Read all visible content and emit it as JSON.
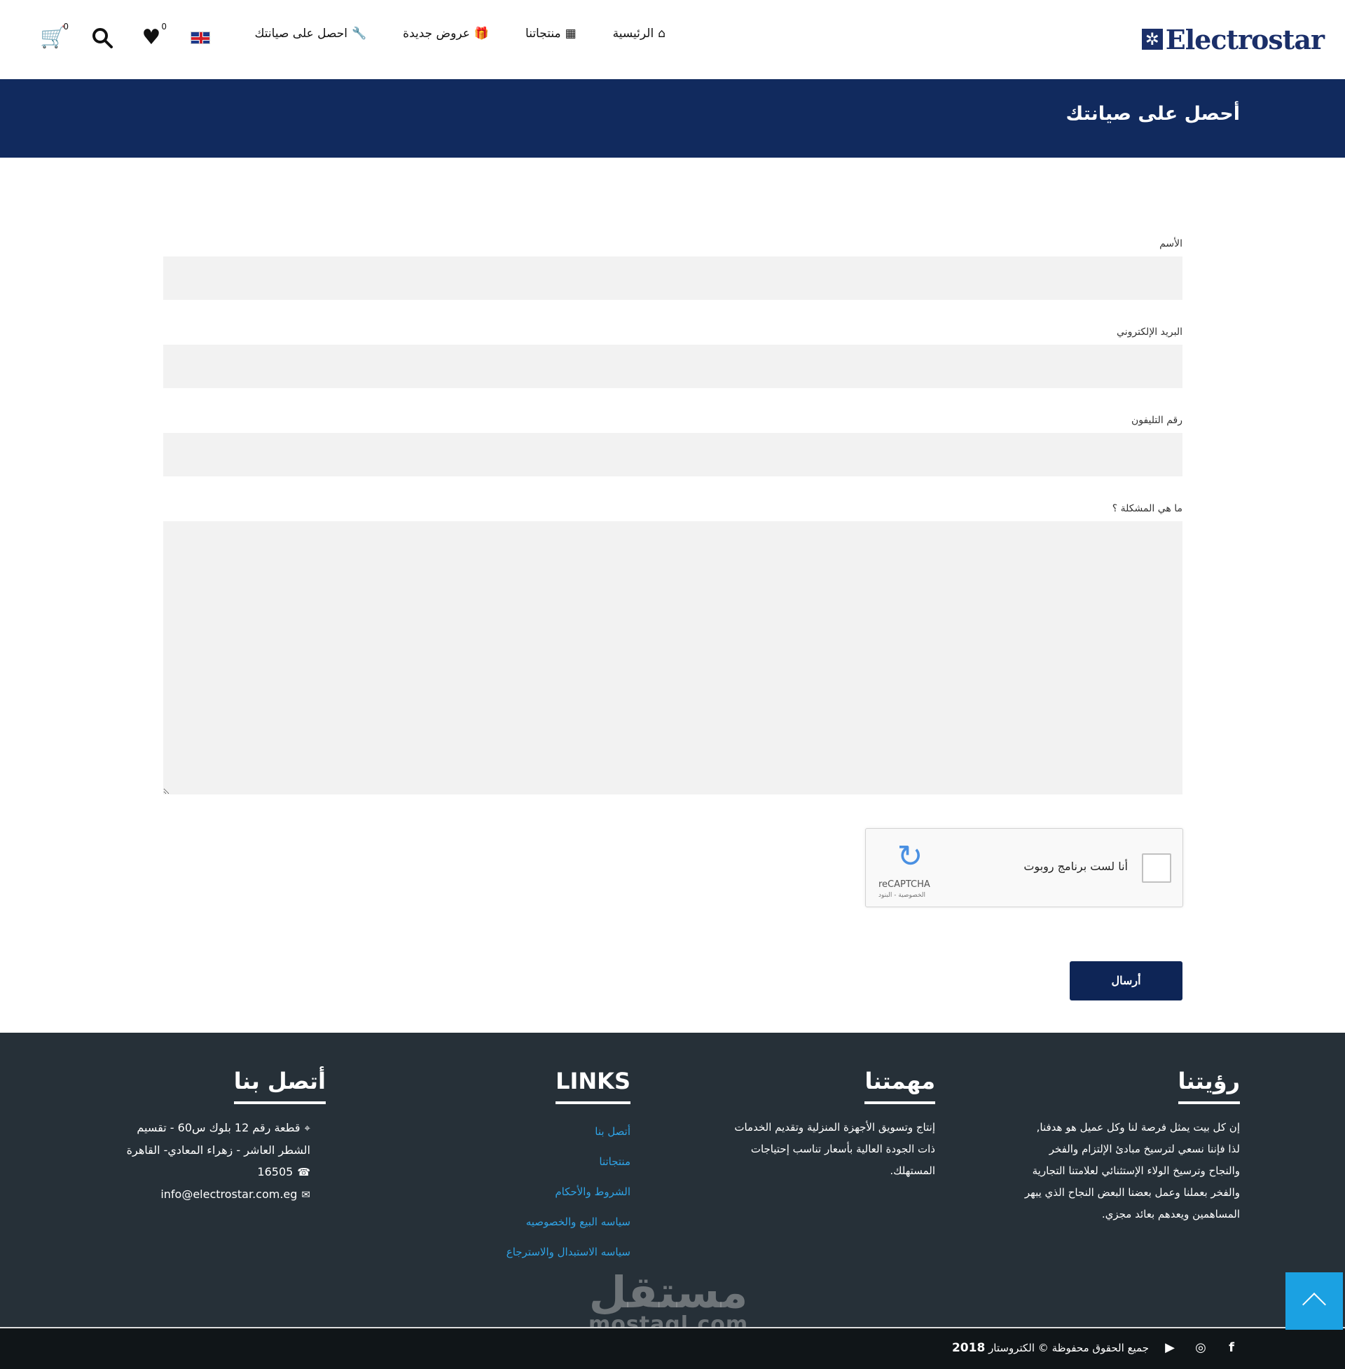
{
  "header": {
    "logo_text": "Electrostar",
    "nav": [
      {
        "label": "الرئيسية",
        "icon": "⌂"
      },
      {
        "label": "منتجاتنا",
        "icon": "▦"
      },
      {
        "label": "عروض جديدة",
        "icon": "🎁"
      },
      {
        "label": "احصل على صيانتك",
        "icon": "🔧"
      }
    ],
    "wishlist_count": "0",
    "cart_count": "0"
  },
  "banner": {
    "title": "أحصل على صيانتك"
  },
  "form": {
    "name_label": "الأسم",
    "email_label": "البريد الإلكتروني",
    "phone_label": "رقم التليفون",
    "problem_label": "ما هي المشكلة ؟",
    "captcha_text": "أنا لست برنامج روبوت",
    "captcha_brand": "reCAPTCHA",
    "captcha_terms": "الخصوصية - البنود",
    "submit_label": "أرسال"
  },
  "footer": {
    "vision_title": "رؤيتنا",
    "vision_text": "إن كل بيت يمثل فرصة لنا وكل عميل هو هدفنا, لذا فإننا نسعي لترسيخ مبادئ الإلتزام والفخر والنجاح وترسيخ الولاء الإستثنائي لعلامتنا التجارية والفخر بعملنا وعمل بعضنا البعض النجاح الذي يبهر المساهمين ويعدهم بعائد مجزي.",
    "mission_title": "مهمتنا",
    "mission_text": "إنتاج وتسويق الأجهزة المنزلية وتقديم الخدمات ذات الجودة العالية بأسعار تناسب إحتياجات المستهلك.",
    "links_title": "LINKS",
    "links": [
      "أتصل بنا",
      "منتجاتنا",
      "الشروط والأحكام",
      "سياسه البيع والخصوصيه",
      "سياسه الاستبدال والاسترجاع"
    ],
    "contact_title": "أتصل بنا",
    "address": "قطعة رقم 12 بلوك س60 - تقسيم الشطر العاشر - زهراء المعادي- القاهرة",
    "phone": "16505",
    "email": "info@electrostar.com.eg",
    "watermark_ar": "مستقل",
    "watermark_en": "mostaql.com",
    "copyright": "جميع الحقوق محفوظة © الكتروستار",
    "year": "2018"
  }
}
